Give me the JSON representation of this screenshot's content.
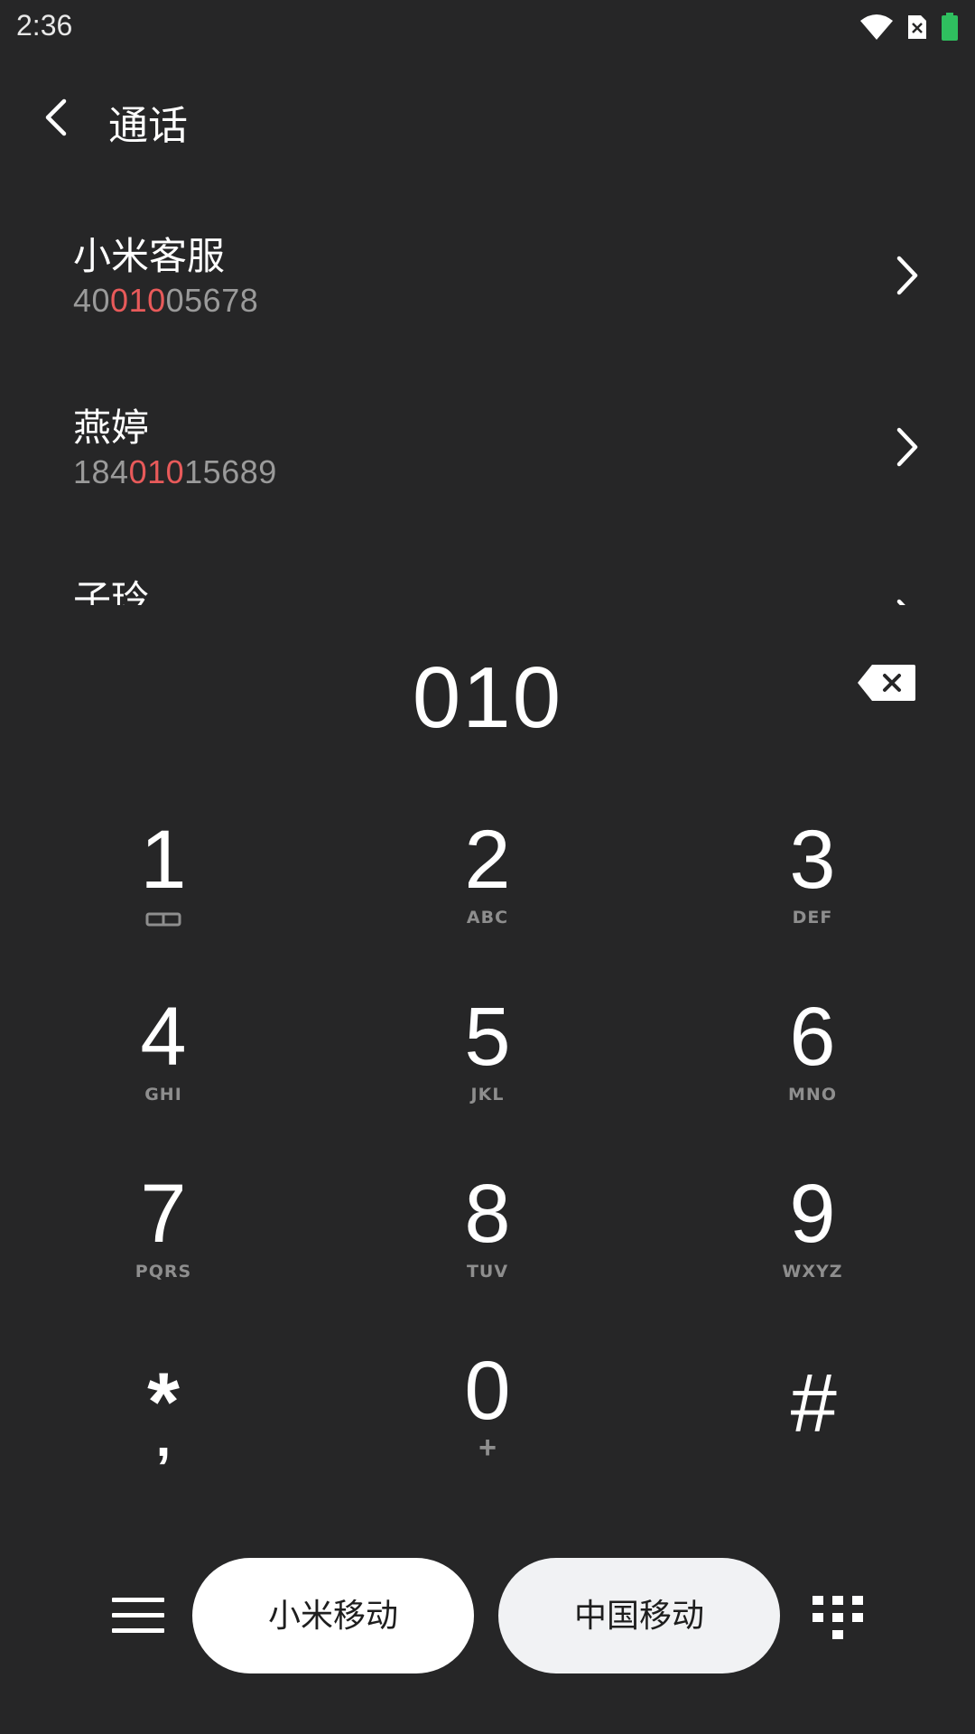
{
  "status_bar": {
    "time": "2:36",
    "icons": [
      "wifi-icon",
      "sim-disabled-icon",
      "battery-icon"
    ],
    "battery_color": "#2fbf5f"
  },
  "header": {
    "title": "通话",
    "back_icon": "chevron-left-icon"
  },
  "matches": [
    {
      "name": "小米客服",
      "number_pre": "40",
      "number_match": "010",
      "number_post": "05678"
    },
    {
      "name": "燕婷",
      "number_pre": "184",
      "number_match": "010",
      "number_post": "15689"
    },
    {
      "name": "子玲",
      "number_pre": "",
      "number_match": "",
      "number_post": ""
    }
  ],
  "dialer": {
    "dialed": "010",
    "highlight_color": "#e85a5a"
  },
  "keypad": {
    "keys": [
      {
        "digit": "1",
        "letters": ""
      },
      {
        "digit": "2",
        "letters": "ABC"
      },
      {
        "digit": "3",
        "letters": "DEF"
      },
      {
        "digit": "4",
        "letters": "GHI"
      },
      {
        "digit": "5",
        "letters": "JKL"
      },
      {
        "digit": "6",
        "letters": "MNO"
      },
      {
        "digit": "7",
        "letters": "PQRS"
      },
      {
        "digit": "8",
        "letters": "TUV"
      },
      {
        "digit": "9",
        "letters": "WXYZ"
      },
      {
        "digit": "*",
        "letters": ","
      },
      {
        "digit": "0",
        "letters": "+"
      },
      {
        "digit": "#",
        "letters": ""
      }
    ]
  },
  "bottom_bar": {
    "sim1_label": "小米移动",
    "sim2_label": "中国移动"
  }
}
